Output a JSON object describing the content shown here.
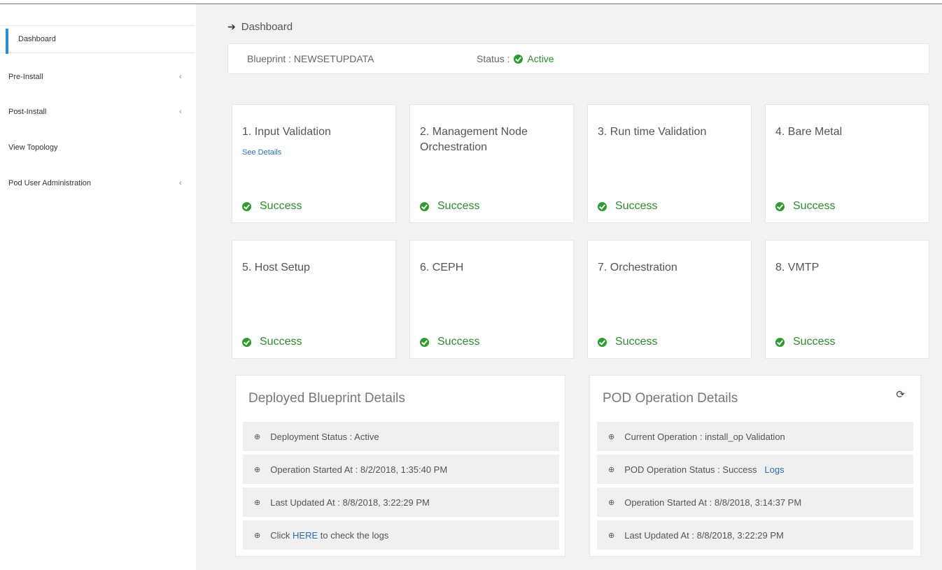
{
  "sidebar": {
    "items": [
      {
        "label": "Dashboard"
      },
      {
        "label": "Pre-Install",
        "chevron": "‹"
      },
      {
        "label": "Post-Install",
        "chevron": "‹"
      },
      {
        "label": "View Topology"
      },
      {
        "label": "Pod User Administration",
        "chevron": "‹"
      }
    ]
  },
  "breadcrumb": {
    "label": "Dashboard"
  },
  "blueprint": {
    "text": "Blueprint : NEWSETUPDATA",
    "status_label": "Status :",
    "status_value": "Active"
  },
  "stages": [
    {
      "title": "1. Input Validation",
      "link": "See Details",
      "status": "Success"
    },
    {
      "title": "2. Management Node Orchestration",
      "status": "Success"
    },
    {
      "title": "3. Run time Validation",
      "status": "Success"
    },
    {
      "title": "4. Bare Metal",
      "status": "Success"
    },
    {
      "title": "5. Host Setup",
      "status": "Success"
    },
    {
      "title": "6. CEPH",
      "status": "Success"
    },
    {
      "title": "7. Orchestration",
      "status": "Success"
    },
    {
      "title": "8. VMTP",
      "status": "Success"
    }
  ],
  "deployed": {
    "title": "Deployed Blueprint Details",
    "rows": [
      "Deployment Status : Active",
      "Operation Started At : 8/2/2018, 1:35:40 PM",
      "Last Updated At : 8/8/2018, 3:22:29 PM"
    ],
    "click_prefix": "Click",
    "click_link": "HERE",
    "click_suffix": "to check the logs"
  },
  "pod": {
    "title": "POD Operation Details",
    "rows": [
      "Current Operation : install_op Validation",
      "POD Operation Status : Success",
      "Operation Started At : 8/8/2018, 3:14:37 PM",
      "Last Updated At : 8/8/2018, 3:22:29 PM"
    ],
    "logs_link": "Logs"
  },
  "colors": {
    "accent": "#2a8cd6",
    "success": "#2e8b2e",
    "link": "#2a6fb5"
  },
  "icons": {
    "bullet": "⊕",
    "refresh": "⟳",
    "arrow": "➔"
  }
}
